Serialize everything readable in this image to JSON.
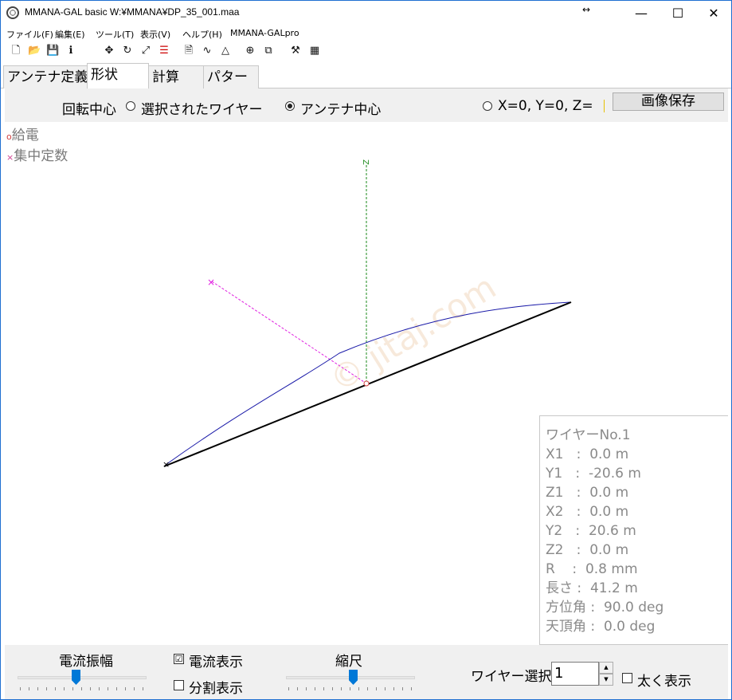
{
  "window": {
    "title": "MMANA-GAL basic  W:¥MMANA¥DP_35_001.maa",
    "resize_glyph": "↔",
    "min_glyph": "—",
    "max_glyph": "☐",
    "close_glyph": "✕"
  },
  "menu": {
    "items": [
      "ファイル(F)",
      "編集(E)",
      "ツール(T)",
      "表示(V)",
      "ヘルプ(H)",
      "MMANA-GALpro"
    ]
  },
  "toolbar": {
    "icons": [
      "new-file-icon",
      "open-folder-icon",
      "save-disk-icon",
      "info-icon",
      "move-arrows-icon",
      "rotate-icon",
      "resize-icon",
      "wires-icon",
      "document-icon",
      "curve-icon",
      "triangle-icon",
      "crosshair-icon",
      "copy-icon",
      "tools-icon",
      "calculator-icon"
    ]
  },
  "tabs": {
    "items": [
      "アンテナ定義",
      "形状",
      "計算",
      "パターン"
    ],
    "active": "形状"
  },
  "rotation": {
    "label": "回転中心",
    "option_selected_wire": "選択されたワイヤー",
    "option_antenna_center": "アンテナ中心",
    "option_origin": "X=0, Y=0, Z=",
    "selected": "アンテナ中心",
    "save_image_label": "画像保存"
  },
  "legend": {
    "feed_mark": "o",
    "feed_label": "給電",
    "load_mark": "×",
    "load_label": "集中定数"
  },
  "wire_info": {
    "title": "ワイヤーNo.1",
    "lines": [
      "X1   :  0.0 m",
      "Y1   :  -20.6 m",
      "Z1   :  0.0 m",
      "X2   :  0.0 m",
      "Y2   :  20.6 m",
      "Z2   :  0.0 m",
      "R    :  0.8 mm",
      "長さ :  41.2 m",
      "方位角 :  90.0 deg",
      "天頂角 :  0.0 deg"
    ]
  },
  "axes": {
    "z_label": "Z"
  },
  "watermark": "© jitaj.com",
  "bottom": {
    "current_amp_label": "電流振幅",
    "current_amp_level": 0.45,
    "show_current_label": "電流表示",
    "show_current_checked": true,
    "show_segments_label": "分割表示",
    "show_segments_checked": false,
    "scale_label": "縮尺",
    "scale_level": 0.52,
    "wire_select_label": "ワイヤー選択",
    "wire_select_value": "1",
    "bold_label": "太く表示",
    "bold_checked": false
  },
  "colors": {
    "accent": "#0078d7",
    "wire": "#000000",
    "current": "#1a1aa8",
    "x_axis": "#e020e0",
    "z_axis": "#1a8a1a"
  }
}
